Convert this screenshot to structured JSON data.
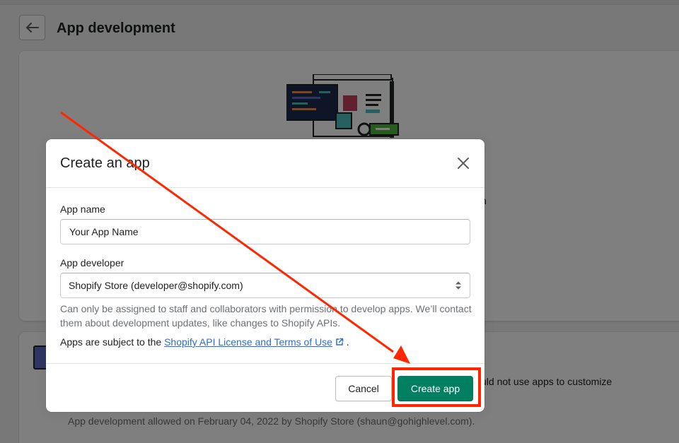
{
  "page": {
    "title": "App development",
    "partial_text_right": "n",
    "partial_text_customize": "uld not use apps to customize",
    "footer_text": "App development allowed on February 04, 2022 by Shopify Store (shaun@gohighlevel.com)."
  },
  "modal": {
    "title": "Create an app",
    "app_name_label": "App name",
    "app_name_value": "Your App Name",
    "app_developer_label": "App developer",
    "app_developer_value": "Shopify Store (developer@shopify.com)",
    "help_text": "Can only be assigned to staff and collaborators with permission to develop apps. We’ll contact them about development updates, like changes to Shopify APIs.",
    "terms_prefix": "Apps are subject to the",
    "terms_link": "Shopify API License and Terms of Use",
    "terms_suffix": ".",
    "cancel_label": "Cancel",
    "create_label": "Create app"
  },
  "icons": {
    "back": "arrow-left-icon",
    "close": "close-icon",
    "select": "select-chevron-icon",
    "external": "external-link-icon"
  },
  "colors": {
    "primary_button": "#008060",
    "link": "#2c6ecb",
    "annotation": "#ff2600",
    "overlay": "rgba(0,0,0,0.5)"
  }
}
